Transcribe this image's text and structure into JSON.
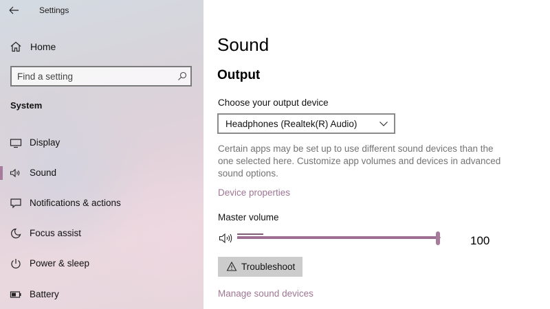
{
  "app": {
    "title": "Settings"
  },
  "sidebar": {
    "home_label": "Home",
    "search": {
      "placeholder": "Find a setting"
    },
    "section_title": "System",
    "items": [
      {
        "label": "Display",
        "icon": "display-icon",
        "selected": false
      },
      {
        "label": "Sound",
        "icon": "speaker-icon",
        "selected": true
      },
      {
        "label": "Notifications & actions",
        "icon": "notifications-icon",
        "selected": false
      },
      {
        "label": "Focus assist",
        "icon": "moon-icon",
        "selected": false
      },
      {
        "label": "Power & sleep",
        "icon": "power-icon",
        "selected": false
      },
      {
        "label": "Battery",
        "icon": "battery-icon",
        "selected": false
      }
    ]
  },
  "main": {
    "title": "Sound",
    "output_title": "Output",
    "choose_label": "Choose your output device",
    "device_selected": "Headphones (Realtek(R) Audio)",
    "description": "Certain apps may be set up to use different sound devices than the one selected here. Customize app volumes and devices in advanced sound options.",
    "device_properties_link": "Device properties",
    "master_volume_label": "Master volume",
    "volume_value": "100",
    "volume_level": 1.0,
    "troubleshoot_label": "Troubleshoot",
    "manage_link": "Manage sound devices"
  },
  "colors": {
    "accent": "#a77c9a",
    "link": "#9e7694",
    "desc_text": "#737373"
  }
}
